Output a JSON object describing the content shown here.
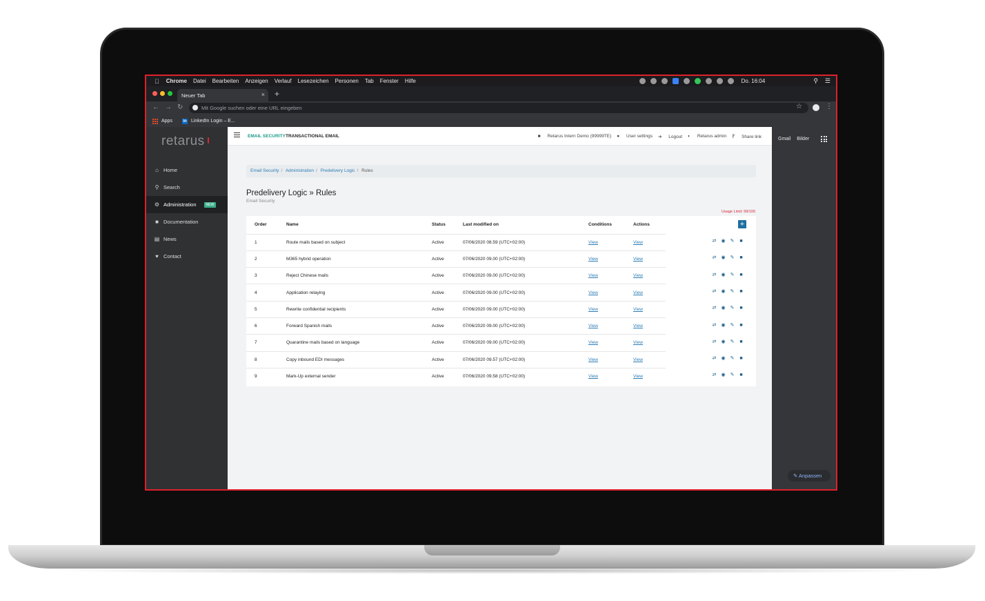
{
  "menubar": {
    "app": "Chrome",
    "items": [
      "Datei",
      "Bearbeiten",
      "Anzeigen",
      "Verlauf",
      "Lesezeichen",
      "Personen",
      "Tab",
      "Fenster",
      "Hilfe"
    ],
    "clock": "Do. 16:04"
  },
  "browser": {
    "tab_title": "Neuer Tab",
    "omnibox_placeholder": "Mit Google suchen oder eine URL eingeben",
    "bookmarks": [
      "Apps",
      "LinkedIn Login – E..."
    ]
  },
  "sidebar": {
    "logo": "retarus",
    "items": [
      {
        "label": "Home",
        "icon": "home-icon"
      },
      {
        "label": "Search",
        "icon": "search-icon"
      },
      {
        "label": "Administration",
        "icon": "gears-icon",
        "badge": "NEW",
        "active": true
      },
      {
        "label": "Documentation",
        "icon": "book-icon"
      },
      {
        "label": "News",
        "icon": "newspaper-icon"
      },
      {
        "label": "Contact",
        "icon": "handshake-icon"
      }
    ]
  },
  "topbar": {
    "tabs": [
      "EMAIL SECURITY",
      "TRANSACTIONAL EMAIL"
    ],
    "right": [
      "Retarus Intern Demo (99999TE)",
      "User settings",
      "Logout",
      "Retarus admin",
      "Share link"
    ]
  },
  "breadcrumb": [
    "Email Security",
    "Administration",
    "Predelivery Logic",
    "Rules"
  ],
  "page": {
    "title": "Predelivery Logic » Rules",
    "subtitle": "Email Security",
    "usage": "Usage Limit: 99/100"
  },
  "table": {
    "headers": [
      "Order",
      "Name",
      "Status",
      "Last modified on",
      "Conditions",
      "Actions"
    ],
    "rows": [
      {
        "order": "1",
        "name": "Route mails based on subject",
        "status": "Active",
        "modified": "07/06/2020 08.59 (UTC+02:00)",
        "conditions": "View",
        "actions": "View"
      },
      {
        "order": "2",
        "name": "M365 hybrid operation",
        "status": "Active",
        "modified": "07/06/2020 09.00 (UTC+02:00)",
        "conditions": "View",
        "actions": "View"
      },
      {
        "order": "3",
        "name": "Reject Chinese mails",
        "status": "Active",
        "modified": "07/06/2020 09.00 (UTC+02:00)",
        "conditions": "View",
        "actions": "View"
      },
      {
        "order": "4",
        "name": "Application relaying",
        "status": "Active",
        "modified": "07/06/2020 09.00 (UTC+02:00)",
        "conditions": "View",
        "actions": "View"
      },
      {
        "order": "5",
        "name": "Rewrite confidential recipients",
        "status": "Active",
        "modified": "07/06/2020 09.00 (UTC+02:00)",
        "conditions": "View",
        "actions": "View"
      },
      {
        "order": "6",
        "name": "Forward Spanish mails",
        "status": "Active",
        "modified": "07/06/2020 09.00 (UTC+02:00)",
        "conditions": "View",
        "actions": "View"
      },
      {
        "order": "7",
        "name": "Quarantine mails based on language",
        "status": "Active",
        "modified": "07/06/2020 09.00 (UTC+02:00)",
        "conditions": "View",
        "actions": "View"
      },
      {
        "order": "8",
        "name": "Copy inbound EDI messages",
        "status": "Active",
        "modified": "07/06/2020 09.57 (UTC+02:00)",
        "conditions": "View",
        "actions": "View"
      },
      {
        "order": "9",
        "name": "Mark-Up external sender",
        "status": "Active",
        "modified": "07/06/2020 09.58 (UTC+02:00)",
        "conditions": "View",
        "actions": "View"
      }
    ]
  },
  "right_panel": {
    "links": [
      "Gmail",
      "Bilder"
    ],
    "customize": "Anpassen"
  },
  "colors": {
    "accent": "#1c9a8a",
    "link": "#2c7cb5",
    "brand_red": "#d9263a",
    "highlight_border": "#e0202a"
  }
}
